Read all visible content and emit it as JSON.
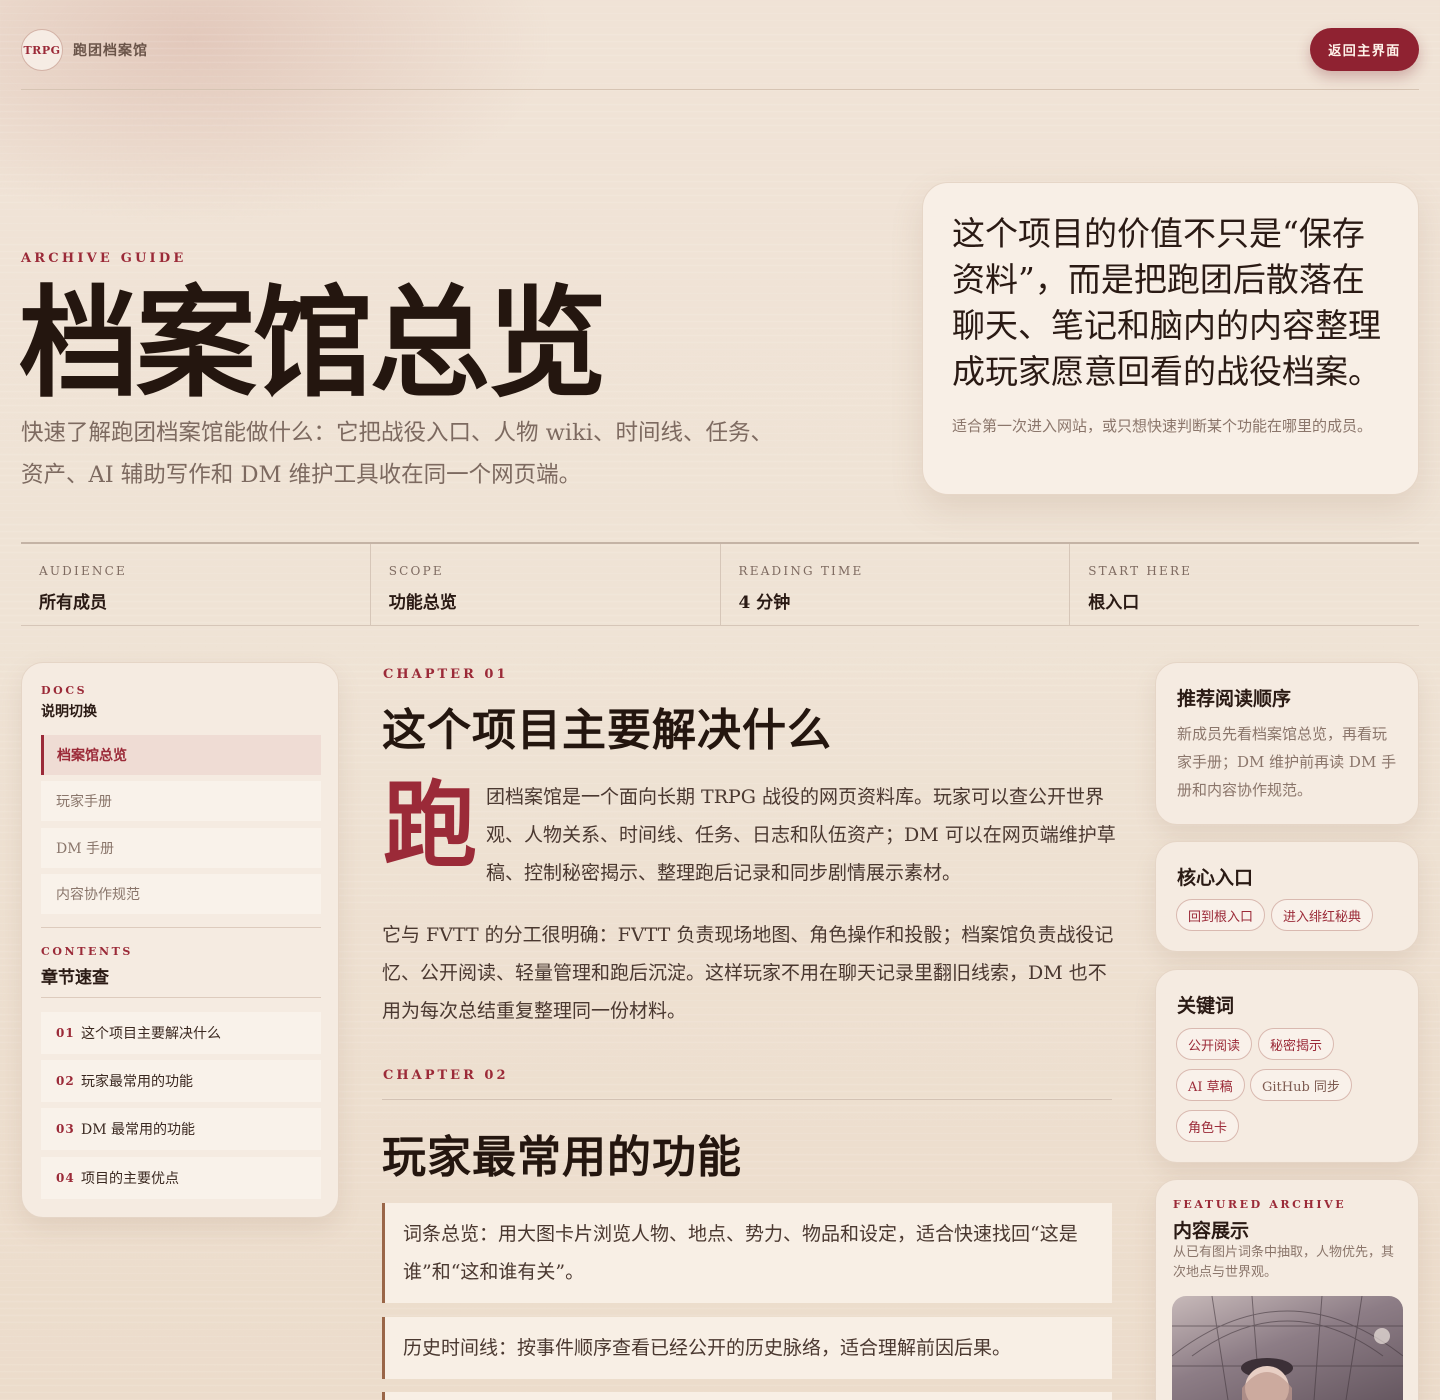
{
  "header": {
    "logo_text": "TRPG",
    "site_name": "跑团档案馆",
    "back_button": "返回主界面"
  },
  "hero": {
    "eyebrow": "ARCHIVE GUIDE",
    "title": "档案馆总览",
    "description": "快速了解跑团档案馆能做什么：它把战役入口、人物 wiki、时间线、任务、资产、AI 辅助写作和 DM 维护工具收在同一个网页端。",
    "quote": "这个项目的价值不只是“保存资料”，而是把跑团后散落在聊天、笔记和脑内的内容整理成玩家愿意回看的战役档案。",
    "quote_note": "适合第一次进入网站，或只想快速判断某个功能在哪里的成员。"
  },
  "stats": [
    {
      "label": "AUDIENCE",
      "value": "所有成员"
    },
    {
      "label": "SCOPE",
      "value": "功能总览"
    },
    {
      "label": "READING TIME",
      "value": "4 分钟"
    },
    {
      "label": "START HERE",
      "value": "根入口"
    }
  ],
  "sidebar": {
    "docs_eyebrow": "DOCS",
    "docs_title": "说明切换",
    "docs": [
      "档案馆总览",
      "玩家手册",
      "DM 手册",
      "内容协作规范"
    ],
    "contents_eyebrow": "CONTENTS",
    "contents_title": "章节速查",
    "toc": [
      {
        "num": "01",
        "label": "这个项目主要解决什么"
      },
      {
        "num": "02",
        "label": "玩家最常用的功能"
      },
      {
        "num": "03",
        "label": "DM 最常用的功能"
      },
      {
        "num": "04",
        "label": "项目的主要优点"
      }
    ]
  },
  "main": {
    "chapter1": {
      "eyebrow": "CHAPTER 01",
      "title": "这个项目主要解决什么",
      "drop_cap": "跑",
      "para1": "团档案馆是一个面向长期 TRPG 战役的网页资料库。玩家可以查公开世界观、人物关系、时间线、任务、日志和队伍资产；DM 可以在网页端维护草稿、控制秘密揭示、整理跑后记录和同步剧情展示素材。",
      "para2": "它与 FVTT 的分工很明确：FVTT 负责现场地图、角色操作和投骰；档案馆负责战役记忆、公开阅读、轻量管理和跑后沉淀。这样玩家不用在聊天记录里翻旧线索，DM 也不用为每次总结重复整理同一份材料。"
    },
    "chapter2": {
      "eyebrow": "CHAPTER 02",
      "title": "玩家最常用的功能",
      "features": [
        "词条总览：用大图卡片浏览人物、地点、势力、物品和设定，适合快速找回“这是谁”和“这和谁有关”。",
        "历史时间线：按事件顺序查看已经公开的历史脉络，适合理解前因后果。"
      ]
    }
  },
  "rail": {
    "reading_order": {
      "title": "推荐阅读顺序",
      "text": "新成员先看档案馆总览，再看玩家手册；DM 维护前再读 DM 手册和内容协作规范。"
    },
    "core_entry": {
      "title": "核心入口",
      "links": [
        "回到根入口",
        "进入绯红秘典"
      ]
    },
    "keywords": {
      "title": "关键词",
      "tags": [
        "公开阅读",
        "秘密揭示",
        "AI 草稿",
        "GitHub 同步",
        "角色卡"
      ]
    },
    "featured": {
      "eyebrow": "FEATURED ARCHIVE",
      "title": "内容展示",
      "text": "从已有图片词条中抽取，人物优先，其次地点与世界观。"
    }
  }
}
